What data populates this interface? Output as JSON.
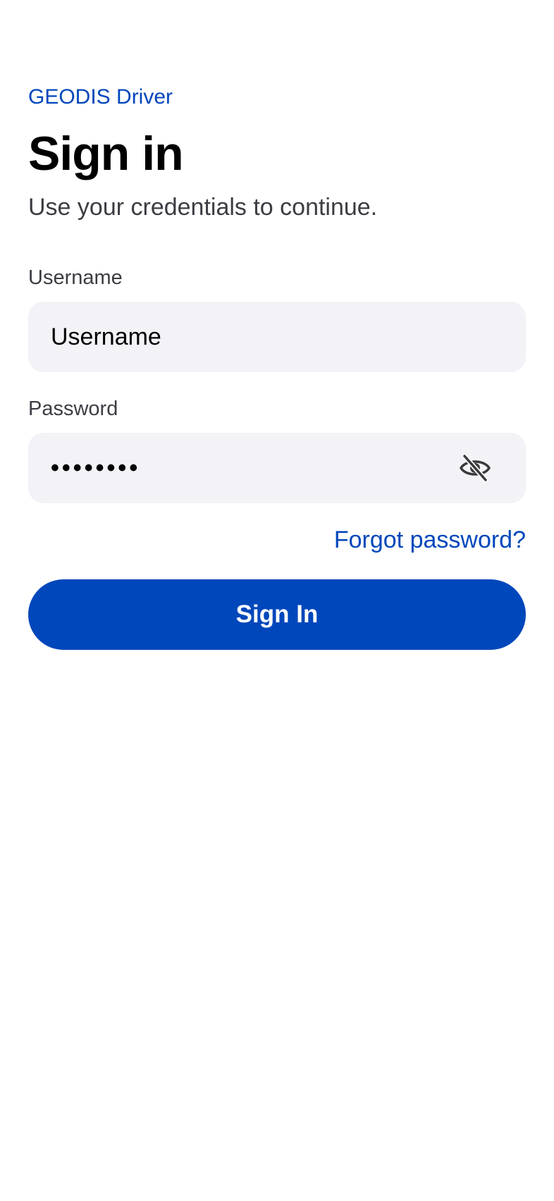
{
  "header": {
    "app_name": "GEODIS Driver",
    "title": "Sign in",
    "subtitle": "Use your credentials to continue."
  },
  "form": {
    "username": {
      "label": "Username",
      "placeholder": "Username",
      "value": ""
    },
    "password": {
      "label": "Password",
      "masked_value": "••••••••",
      "visibility_icon": "eye-slash-icon"
    },
    "forgot_password_label": "Forgot password?",
    "submit_label": "Sign In"
  },
  "colors": {
    "accent": "#0047BB",
    "input_background": "#F2F2F7",
    "label_text": "#3C3C43"
  }
}
